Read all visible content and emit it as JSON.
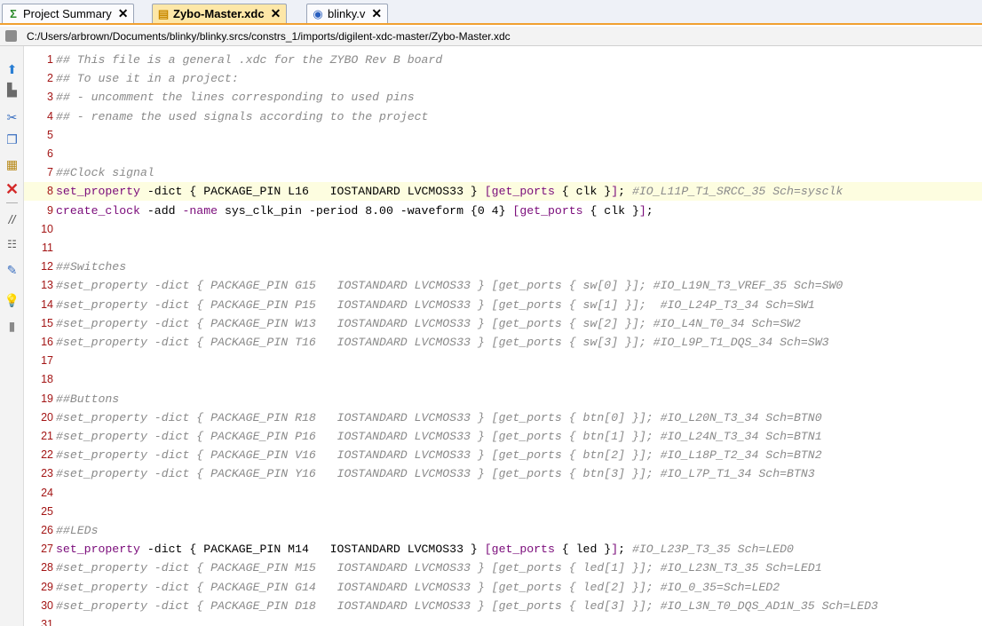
{
  "tabs": [
    {
      "label": "Project Summary",
      "icon": "sigma-icon",
      "active": false
    },
    {
      "label": "Zybo-Master.xdc",
      "icon": "xdc-file-icon",
      "active": true
    },
    {
      "label": "blinky.v",
      "icon": "verilog-file-icon",
      "active": false
    }
  ],
  "path": "C:/Users/arbrown/Documents/blinky/blinky.srcs/constrs_1/imports/digilent-xdc-master/Zybo-Master.xdc",
  "toolbar": [
    "open-file-icon",
    "save-icon",
    "cut-icon",
    "copy-icon",
    "paste-icon",
    "delete-icon",
    "comment-icon",
    "select-all-icon",
    "replace-icon",
    "bulb-icon",
    "stamp-icon"
  ],
  "colors": {
    "active_tab": "#fde7a8",
    "accent": "#f0a030",
    "line_numbers": "#a31515",
    "comment": "#8a8a8a",
    "keyword": "#7a0b7a"
  },
  "lines": [
    {
      "n": "1",
      "segs": [
        [
          "cm",
          "## This file is a general .xdc for the ZYBO Rev B board"
        ]
      ]
    },
    {
      "n": "2",
      "segs": [
        [
          "cm",
          "## To use it in a project:"
        ]
      ]
    },
    {
      "n": "3",
      "segs": [
        [
          "cm",
          "## - uncomment the lines corresponding to used pins"
        ]
      ]
    },
    {
      "n": "4",
      "segs": [
        [
          "cm",
          "## - rename the used signals according to the project"
        ]
      ]
    },
    {
      "n": "5",
      "segs": []
    },
    {
      "n": "6",
      "segs": []
    },
    {
      "n": "7",
      "segs": [
        [
          "cm",
          "##Clock signal"
        ]
      ]
    },
    {
      "n": "8",
      "hl": true,
      "segs": [
        [
          "kw",
          "set_property"
        ],
        [
          "pl",
          " -dict { PACKAGE_PIN L16   IOSTANDARD LVCMOS33 } "
        ],
        [
          "kw",
          "[get_ports"
        ],
        [
          "pl",
          " { clk }"
        ],
        [
          "kw",
          "]"
        ],
        [
          "pl",
          "; "
        ],
        [
          "cm",
          "#IO_L11P_T1_SRCC_35 Sch=sysclk"
        ]
      ]
    },
    {
      "n": "9",
      "segs": [
        [
          "kw",
          "create_clock"
        ],
        [
          "pl",
          " -add "
        ],
        [
          "kw",
          "-name"
        ],
        [
          "pl",
          " sys_clk_pin -period 8.00 -waveform {0 4} "
        ],
        [
          "kw",
          "[get_ports"
        ],
        [
          "pl",
          " { clk }"
        ],
        [
          "kw",
          "]"
        ],
        [
          "pl",
          ";"
        ]
      ]
    },
    {
      "n": "10",
      "segs": []
    },
    {
      "n": "11",
      "segs": []
    },
    {
      "n": "12",
      "segs": [
        [
          "cm",
          "##Switches"
        ]
      ]
    },
    {
      "n": "13",
      "segs": [
        [
          "cm",
          "#set_property -dict { PACKAGE_PIN G15   IOSTANDARD LVCMOS33 } [get_ports { sw[0] }]; #IO_L19N_T3_VREF_35 Sch=SW0"
        ]
      ]
    },
    {
      "n": "14",
      "segs": [
        [
          "cm",
          "#set_property -dict { PACKAGE_PIN P15   IOSTANDARD LVCMOS33 } [get_ports { sw[1] }];  #IO_L24P_T3_34 Sch=SW1"
        ]
      ]
    },
    {
      "n": "15",
      "segs": [
        [
          "cm",
          "#set_property -dict { PACKAGE_PIN W13   IOSTANDARD LVCMOS33 } [get_ports { sw[2] }]; #IO_L4N_T0_34 Sch=SW2"
        ]
      ]
    },
    {
      "n": "16",
      "segs": [
        [
          "cm",
          "#set_property -dict { PACKAGE_PIN T16   IOSTANDARD LVCMOS33 } [get_ports { sw[3] }]; #IO_L9P_T1_DQS_34 Sch=SW3"
        ]
      ]
    },
    {
      "n": "17",
      "segs": []
    },
    {
      "n": "18",
      "segs": []
    },
    {
      "n": "19",
      "segs": [
        [
          "cm",
          "##Buttons"
        ]
      ]
    },
    {
      "n": "20",
      "segs": [
        [
          "cm",
          "#set_property -dict { PACKAGE_PIN R18   IOSTANDARD LVCMOS33 } [get_ports { btn[0] }]; #IO_L20N_T3_34 Sch=BTN0"
        ]
      ]
    },
    {
      "n": "21",
      "segs": [
        [
          "cm",
          "#set_property -dict { PACKAGE_PIN P16   IOSTANDARD LVCMOS33 } [get_ports { btn[1] }]; #IO_L24N_T3_34 Sch=BTN1"
        ]
      ]
    },
    {
      "n": "22",
      "segs": [
        [
          "cm",
          "#set_property -dict { PACKAGE_PIN V16   IOSTANDARD LVCMOS33 } [get_ports { btn[2] }]; #IO_L18P_T2_34 Sch=BTN2"
        ]
      ]
    },
    {
      "n": "23",
      "segs": [
        [
          "cm",
          "#set_property -dict { PACKAGE_PIN Y16   IOSTANDARD LVCMOS33 } [get_ports { btn[3] }]; #IO_L7P_T1_34 Sch=BTN3"
        ]
      ]
    },
    {
      "n": "24",
      "segs": []
    },
    {
      "n": "25",
      "segs": []
    },
    {
      "n": "26",
      "segs": [
        [
          "cm",
          "##LEDs"
        ]
      ]
    },
    {
      "n": "27",
      "segs": [
        [
          "kw",
          "set_property"
        ],
        [
          "pl",
          " -dict { PACKAGE_PIN M14   IOSTANDARD LVCMOS33 } "
        ],
        [
          "kw",
          "[get_ports"
        ],
        [
          "pl",
          " { led }"
        ],
        [
          "kw",
          "]"
        ],
        [
          "pl",
          "; "
        ],
        [
          "cm",
          "#IO_L23P_T3_35 Sch=LED0"
        ]
      ]
    },
    {
      "n": "28",
      "segs": [
        [
          "cm",
          "#set_property -dict { PACKAGE_PIN M15   IOSTANDARD LVCMOS33 } [get_ports { led[1] }]; #IO_L23N_T3_35 Sch=LED1"
        ]
      ]
    },
    {
      "n": "29",
      "segs": [
        [
          "cm",
          "#set_property -dict { PACKAGE_PIN G14   IOSTANDARD LVCMOS33 } [get_ports { led[2] }]; #IO_0_35=Sch=LED2"
        ]
      ]
    },
    {
      "n": "30",
      "segs": [
        [
          "cm",
          "#set_property -dict { PACKAGE_PIN D18   IOSTANDARD LVCMOS33 } [get_ports { led[3] }]; #IO_L3N_T0_DQS_AD1N_35 Sch=LED3"
        ]
      ]
    },
    {
      "n": "31",
      "segs": []
    }
  ]
}
